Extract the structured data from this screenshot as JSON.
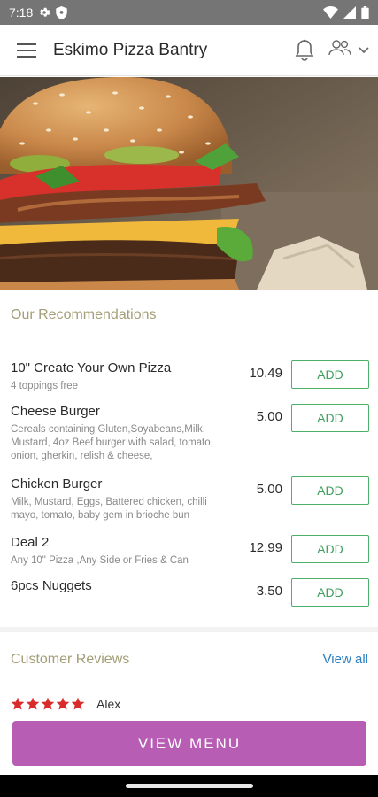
{
  "status_bar": {
    "time": "7:18"
  },
  "app_bar": {
    "title": "Eskimo Pizza Bantry"
  },
  "recommendations": {
    "title": "Our Recommendations",
    "items": [
      {
        "name": "10\" Create Your Own Pizza",
        "desc": "4 toppings free",
        "price": "10.49",
        "button": "ADD"
      },
      {
        "name": "Cheese Burger",
        "desc": "Cereals containing Gluten,Soyabeans,Milk, Mustard, 4oz Beef burger with salad, tomato, onion, gherkin, relish & cheese,",
        "price": "5.00",
        "button": "ADD"
      },
      {
        "name": "Chicken Burger",
        "desc": "Milk, Mustard, Eggs, Battered chicken, chilli mayo, tomato, baby gem in brioche bun",
        "price": "5.00",
        "button": "ADD"
      },
      {
        "name": "Deal 2",
        "desc": "Any 10\" Pizza ,Any Side or Fries & Can",
        "price": "12.99",
        "button": "ADD"
      },
      {
        "name": "6pcs Nuggets",
        "desc": "",
        "price": "3.50",
        "button": "ADD"
      }
    ]
  },
  "reviews": {
    "title": "Customer Reviews",
    "view_all": "View all",
    "first": {
      "rating": 5,
      "name": "Alex"
    }
  },
  "view_menu": "VIEW MENU",
  "colors": {
    "accent_purple": "#b75db4",
    "add_green": "#4caf6a",
    "section_title": "#a39e77",
    "link_blue": "#2a7fbf",
    "star_red": "#d92b2b"
  }
}
